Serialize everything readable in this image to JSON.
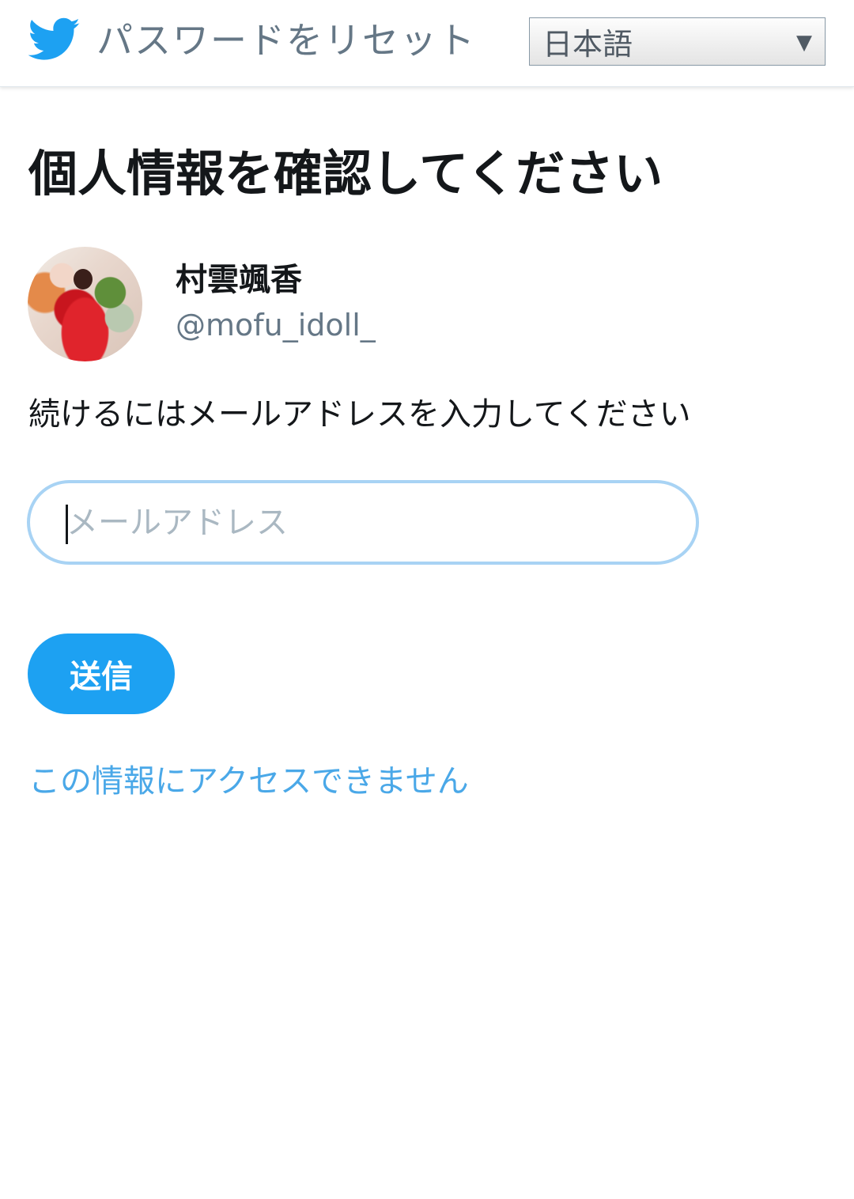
{
  "header": {
    "logo_icon": "twitter-bird-icon",
    "title": "パスワードをリセット",
    "language_select": {
      "selected": "日本語",
      "arrow": "▼"
    }
  },
  "main": {
    "title": "個人情報を確認してください",
    "account": {
      "avatar_icon": "user-avatar",
      "display_name": "村雲颯香",
      "handle": "@mofu_idoll_"
    },
    "instruction": "続けるにはメールアドレスを入力してください",
    "email_input": {
      "placeholder": "メールアドレス",
      "value": ""
    },
    "submit_label": "送信",
    "cant_access_link": "この情報にアクセスできません"
  },
  "colors": {
    "brand": "#1da1f2",
    "link": "#4aa8e8",
    "input_focus_border": "#a8d3f4",
    "secondary_text": "#657786"
  }
}
